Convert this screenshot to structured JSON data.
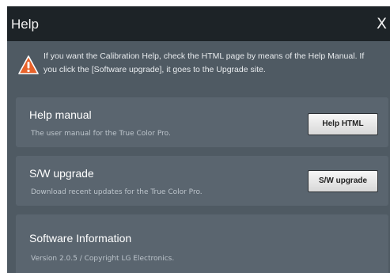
{
  "window": {
    "title": "Help",
    "close_label": "X"
  },
  "notice": {
    "icon": "warning-triangle-icon",
    "line1": "If you want the Calibration Help, check the HTML page by means of the Help Manual. If",
    "line2": "you click the [Software upgrade], it goes to the Upgrade site."
  },
  "sections": {
    "help_manual": {
      "title": "Help manual",
      "description": "The user manual for the True Color Pro.",
      "button_label": "Help HTML"
    },
    "sw_upgrade": {
      "title": "S/W upgrade",
      "description": "Download recent updates for the True Color Pro.",
      "button_label": "S/W upgrade"
    },
    "software_info": {
      "title": "Software Information",
      "description": "Version 2.0.5 / Copyright LG Electronics."
    }
  },
  "colors": {
    "titlebar": "#1d2327",
    "background": "#4f5a63",
    "panel": "#5a656f",
    "warning_orange": "#e8622a"
  }
}
